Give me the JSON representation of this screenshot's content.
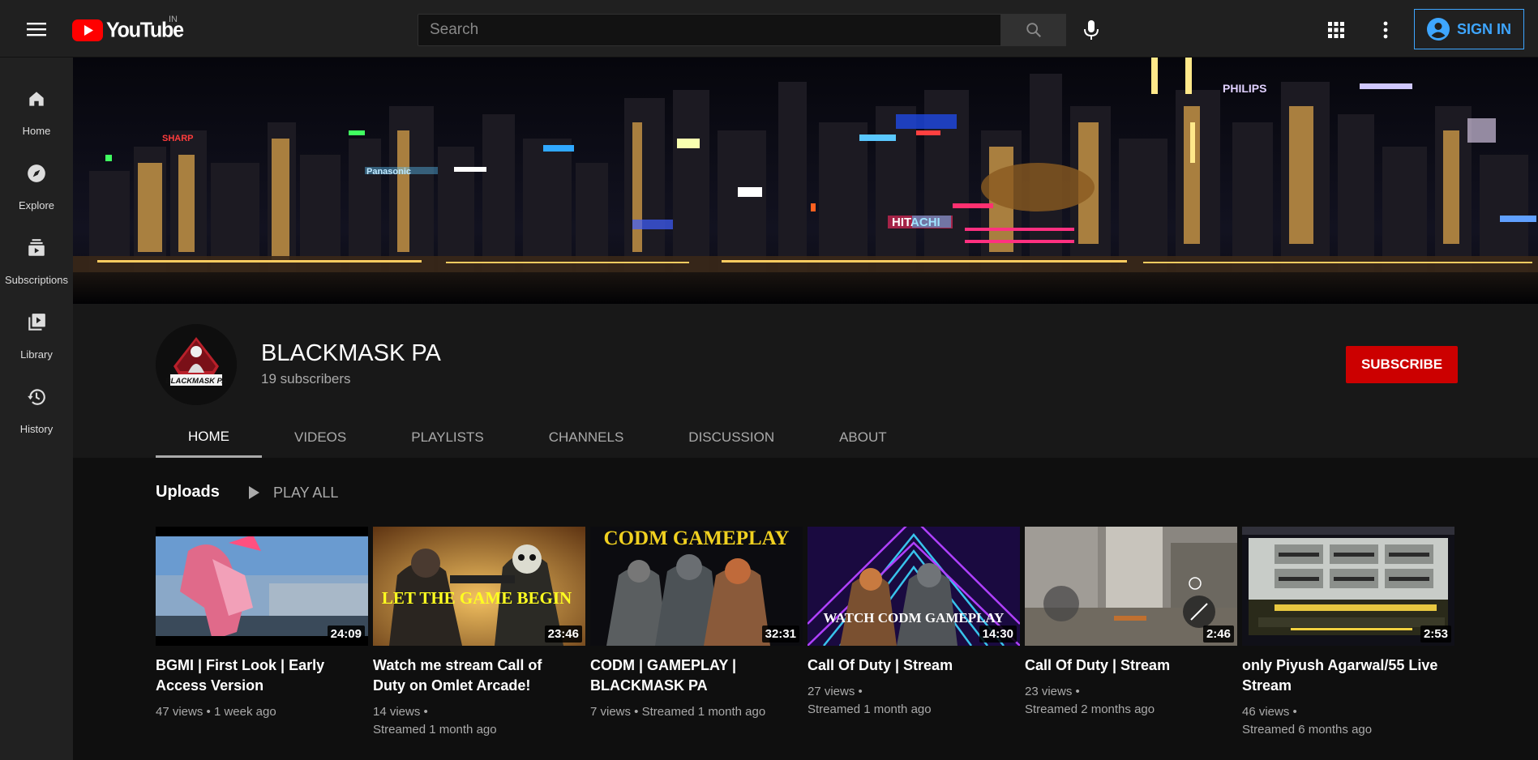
{
  "header": {
    "logo_text": "YouTube",
    "region": "IN",
    "search_placeholder": "Search",
    "signin_label": "SIGN IN"
  },
  "sidebar": {
    "items": [
      {
        "label": "Home",
        "icon": "home-icon"
      },
      {
        "label": "Explore",
        "icon": "compass-icon"
      },
      {
        "label": "Subscriptions",
        "icon": "subscriptions-icon"
      },
      {
        "label": "Library",
        "icon": "library-icon"
      },
      {
        "label": "History",
        "icon": "history-icon"
      }
    ]
  },
  "channel": {
    "name": "BLACKMASK PA",
    "avatar_text": "BLACKMASK PA",
    "subscribers": "19 subscribers",
    "subscribe_label": "SUBSCRIBE",
    "tabs": [
      "HOME",
      "VIDEOS",
      "PLAYLISTS",
      "CHANNELS",
      "DISCUSSION",
      "ABOUT"
    ],
    "active_tab": "HOME"
  },
  "banner": {
    "signs": [
      "SHARP",
      "Panasonic",
      "HITACHI",
      "PHILIPS"
    ]
  },
  "shelf": {
    "title": "Uploads",
    "play_all_label": "PLAY ALL",
    "videos": [
      {
        "title": "BGMI | First Look | Early Access Version",
        "meta1": "47 views • 1 week ago",
        "meta2": "",
        "duration": "24:09",
        "thumb_text": ""
      },
      {
        "title": "Watch me stream Call of Duty on Omlet Arcade!",
        "meta1": "14 views •",
        "meta2": "Streamed 1 month ago",
        "duration": "23:46",
        "thumb_text": "LET THE GAME BEGIN"
      },
      {
        "title": "CODM | GAMEPLAY | BLACKMASK PA",
        "meta1": "7 views • Streamed 1 month ago",
        "meta2": "",
        "duration": "32:31",
        "thumb_text": "CODM GAMEPLAY"
      },
      {
        "title": "Call Of Duty | Stream",
        "meta1": "27 views •",
        "meta2": "Streamed 1 month ago",
        "duration": "14:30",
        "thumb_text": "WATCH CODM GAMEPLAY"
      },
      {
        "title": "Call Of Duty | Stream",
        "meta1": "23 views •",
        "meta2": "Streamed 2 months ago",
        "duration": "2:46",
        "thumb_text": ""
      },
      {
        "title": "only Piyush Agarwal/55 Live Stream",
        "meta1": "46 views •",
        "meta2": "Streamed 6 months ago",
        "duration": "2:53",
        "thumb_text": ""
      }
    ]
  },
  "colors": {
    "accent": "#3ea6ff",
    "subscribe": "#cc0000",
    "youtube_red": "#ff0000",
    "bg_dark": "#181818"
  }
}
